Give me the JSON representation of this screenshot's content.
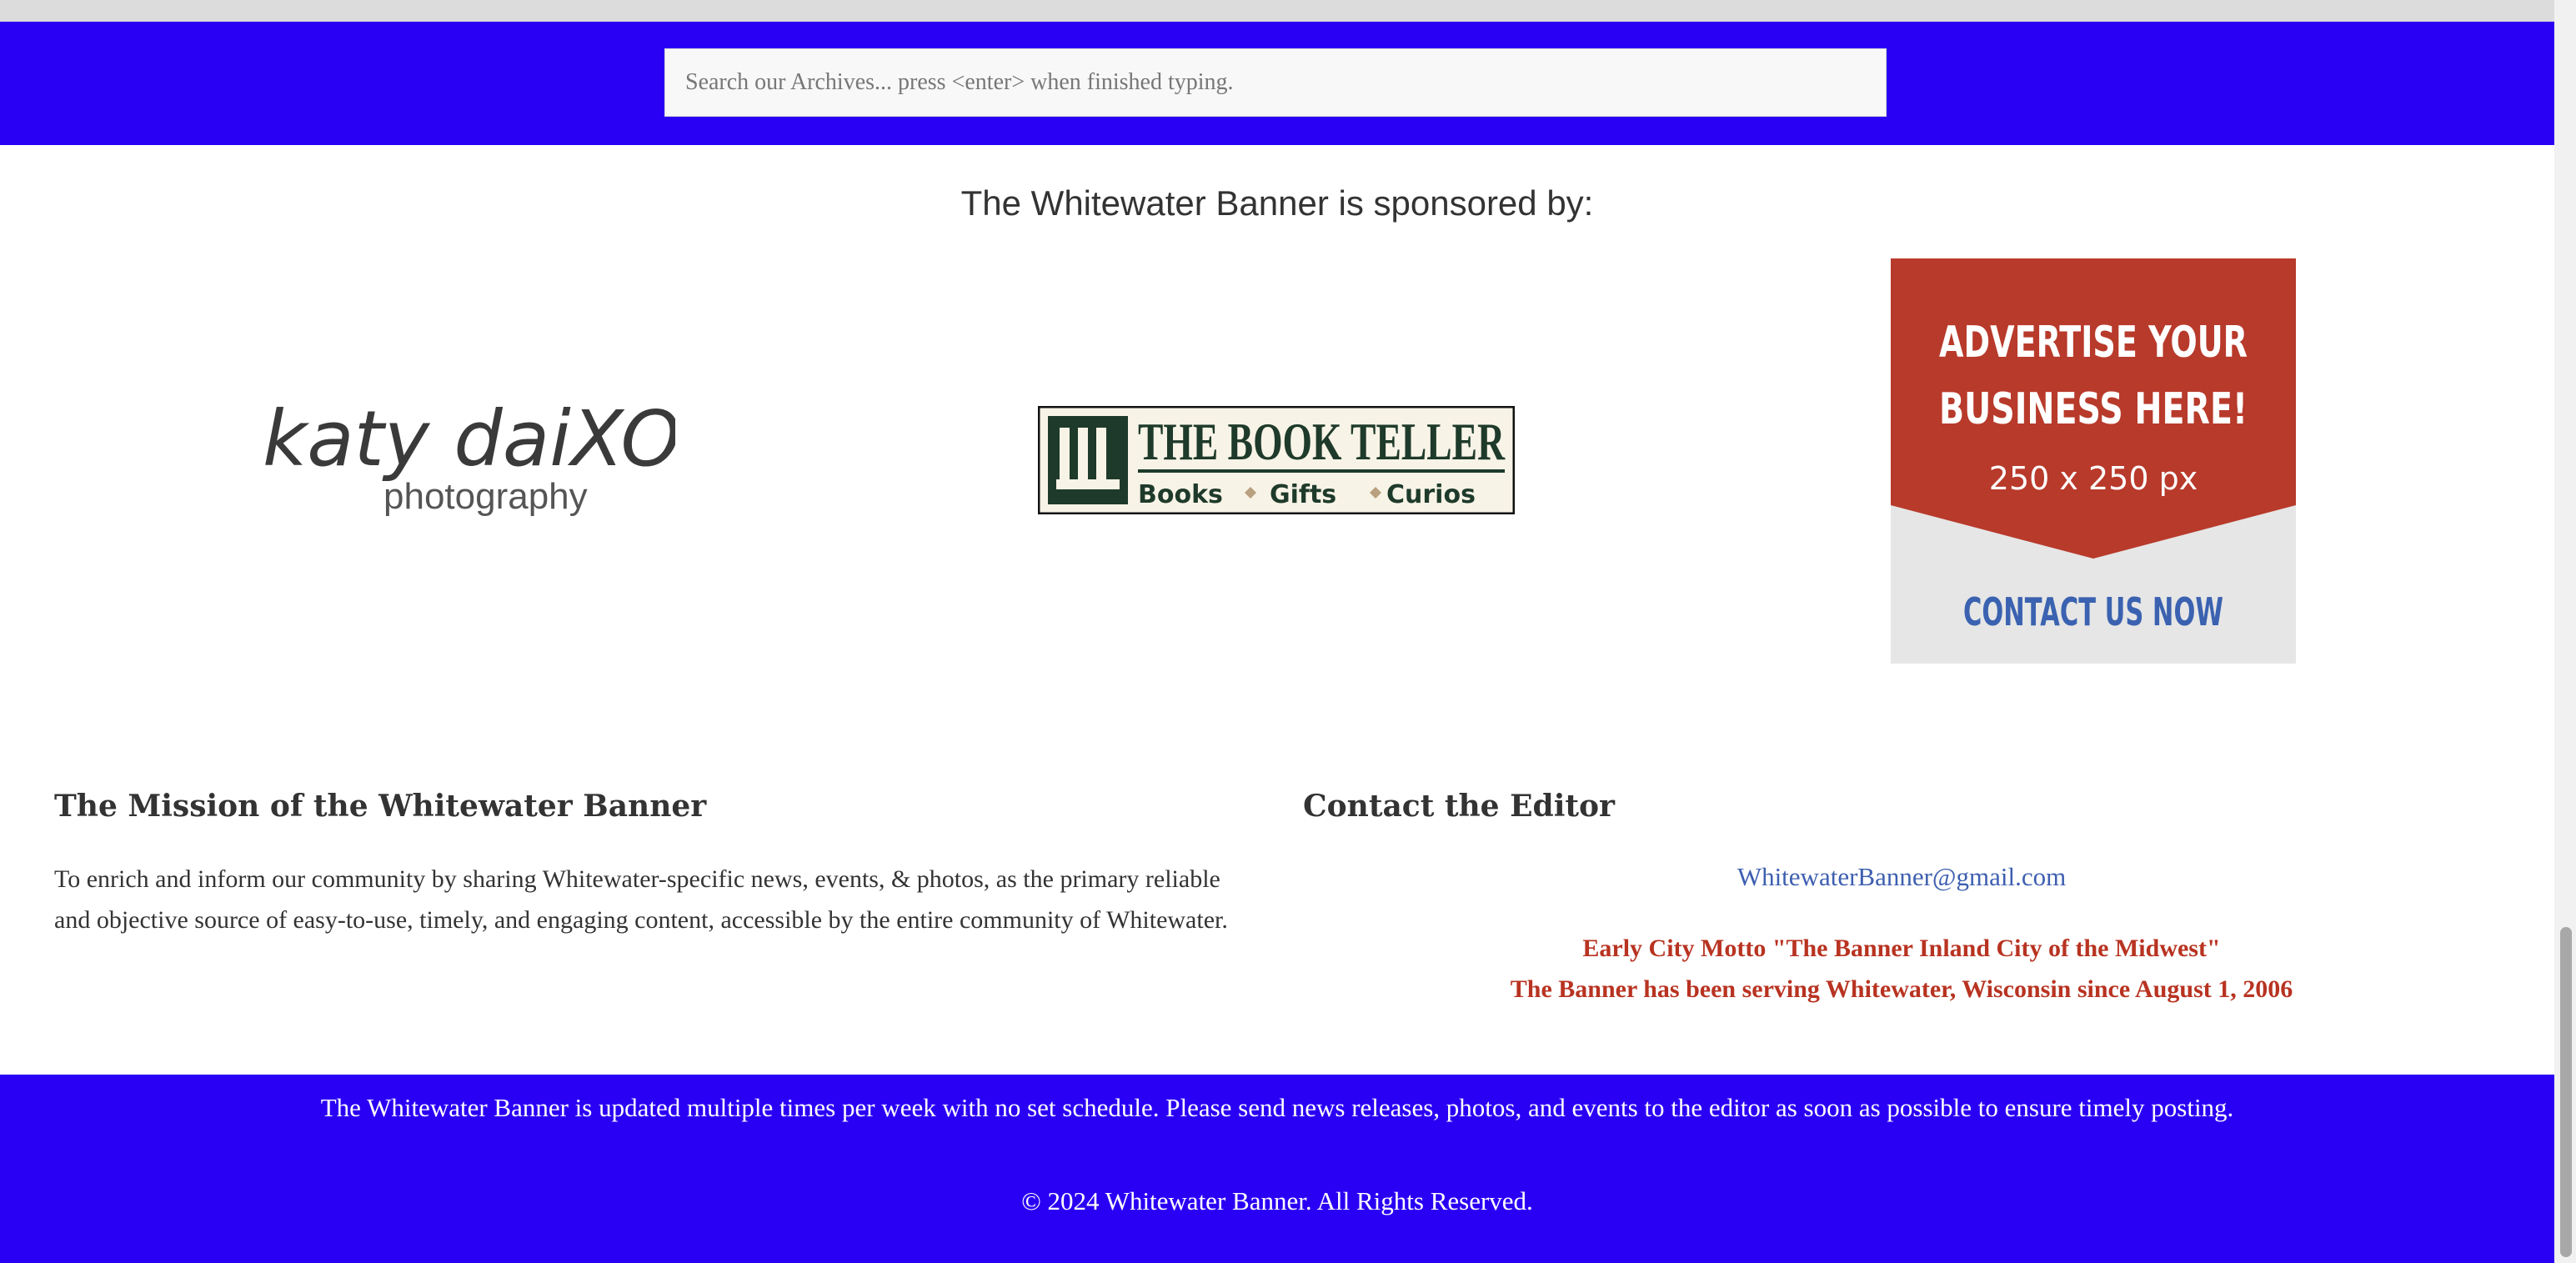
{
  "search": {
    "placeholder": "Search our Archives... press <enter> when finished typing."
  },
  "sponsors": {
    "heading": "The Whitewater Banner is sponsored by:",
    "katy": {
      "line1": "katy daiXOn",
      "line2": "photography"
    },
    "bookteller": {
      "title": "THE BOOK TELLER",
      "items": [
        "Books",
        "Gifts",
        "Curios"
      ]
    },
    "advert": {
      "line1": "ADVERTISE YOUR",
      "line2": "BUSINESS HERE!",
      "size": "250 x 250 px",
      "cta": "CONTACT US NOW"
    }
  },
  "mission": {
    "title": "The Mission of the Whitewater Banner",
    "text": "To enrich and inform our community by sharing Whitewater-specific news, events, & photos, as the primary reliable and objective source of easy-to-use, timely, and engaging content, accessible by the entire community of Whitewater."
  },
  "contact": {
    "title": "Contact the Editor",
    "email": "WhitewaterBanner@gmail.com",
    "motto": "Early City Motto \"The Banner Inland City of the Midwest\"",
    "serving": "The Banner has been serving Whitewater, Wisconsin since August 1, 2006"
  },
  "footer": {
    "note": "The Whitewater Banner is updated multiple times per week with no set schedule. Please send news releases, photos, and events to the editor as soon as possible to ensure timely posting.",
    "copyright": "© 2024 Whitewater Banner. All Rights Reserved."
  },
  "colors": {
    "band": "#2a00f4",
    "motto": "#b83321",
    "link": "#3d5fb0",
    "advert_red": "#b83a2b",
    "advert_blue": "#3a62b0"
  }
}
